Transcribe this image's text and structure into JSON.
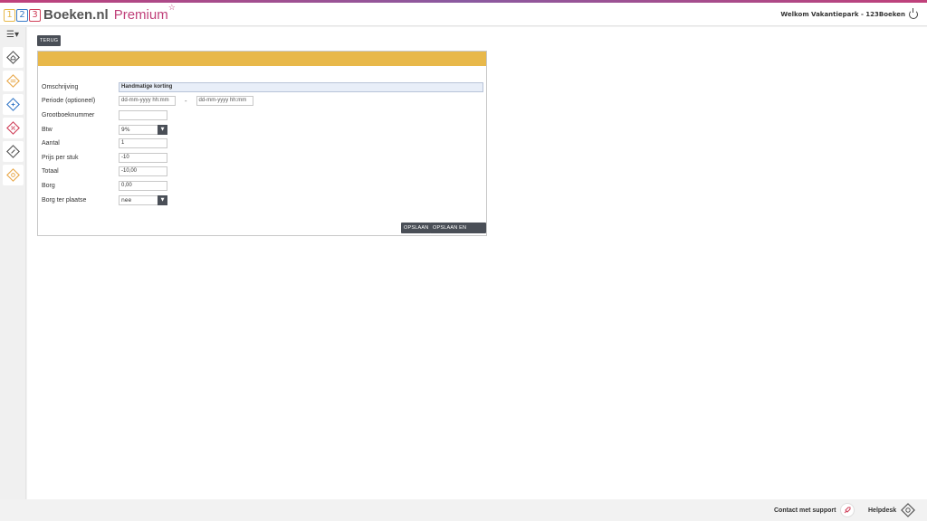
{
  "header": {
    "logo_digits": [
      "1",
      "2",
      "3"
    ],
    "logo_text": "Boeken.nl",
    "logo_premium": "Premium",
    "logo_star": "☆",
    "welcome": "Welkom Vakantiepark - 123Boeken"
  },
  "sidebar": {
    "toggle": "☰▾",
    "items": [
      {
        "icon": "home-icon",
        "color": "#555555"
      },
      {
        "icon": "bed-icon",
        "color": "#e8a84a"
      },
      {
        "icon": "calendar-icon",
        "color": "#3a7bc8"
      },
      {
        "icon": "percent-icon",
        "color": "#d0405a"
      },
      {
        "icon": "ticket-icon",
        "color": "#555555"
      },
      {
        "icon": "settings-icon",
        "color": "#e8a84a"
      }
    ]
  },
  "main": {
    "back_button": "TERUG",
    "form": {
      "omschrijving": {
        "label": "Omschrijving",
        "value": "Handmatige korting"
      },
      "periode": {
        "label": "Periode (optioneel)",
        "from_placeholder": "dd-mm-yyyy hh:mm",
        "separator": "-",
        "to_placeholder": "dd-mm-yyyy hh:mm"
      },
      "grootboeknummer": {
        "label": "Grootboeknummer",
        "value": ""
      },
      "btw": {
        "label": "Btw",
        "value": "9%"
      },
      "aantal": {
        "label": "Aantal",
        "value": "1"
      },
      "prijs": {
        "label": "Prijs per stuk",
        "value": "-10"
      },
      "totaal": {
        "label": "Totaal",
        "value": "-10,00"
      },
      "borg": {
        "label": "Borg",
        "value": "0,00"
      },
      "borg_ter_plaatse": {
        "label": "Borg ter plaatse",
        "value": "nee"
      }
    },
    "save_button": "OPSLAAN",
    "save_back_button": "OPSLAAN EN TERUG"
  },
  "footer": {
    "support": "Contact met support",
    "helpdesk": "Helpdesk"
  }
}
